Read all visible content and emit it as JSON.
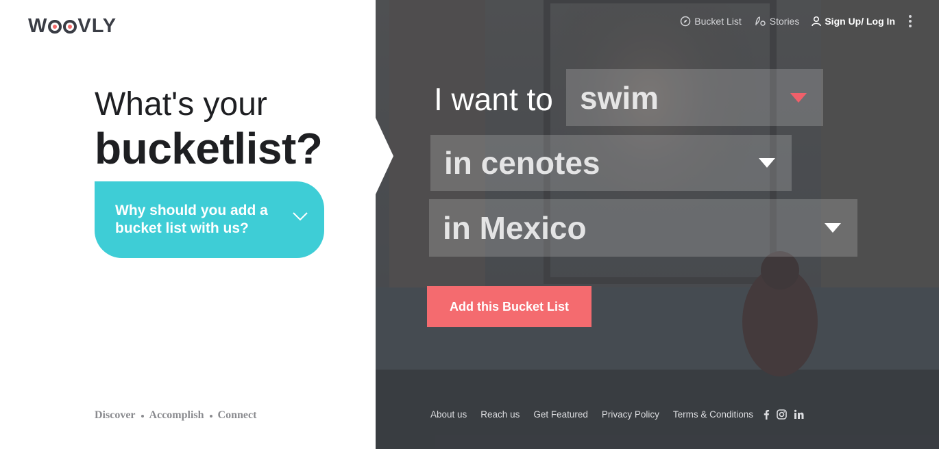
{
  "brand": {
    "logo": "WOOVLY"
  },
  "hero": {
    "line1": "What's your",
    "line2": "bucketlist?",
    "why_button": "Why should you add a bucket list with us?"
  },
  "left_footer": [
    "Discover",
    "Accomplish",
    "Connect"
  ],
  "nav": {
    "bucket_list": "Bucket List",
    "stories": "Stories",
    "login": "Sign Up/ Log In",
    "icons": [
      "compass-icon",
      "stories-icon",
      "user-icon",
      "more-vertical-icon"
    ]
  },
  "builder": {
    "prefix": "I want to",
    "activity": "swim",
    "place": "in cenotes",
    "country": "in Mexico",
    "submit": "Add this Bucket List"
  },
  "right_footer": {
    "links": [
      "About us",
      "Reach us",
      "Get Featured",
      "Privacy Policy",
      "Terms & Conditions"
    ],
    "social_icons": [
      "facebook-icon",
      "instagram-icon",
      "linkedin-icon"
    ]
  },
  "colors": {
    "accent_teal": "#3ecdd6",
    "accent_coral": "#f46b6f",
    "dropdown_arrow_active": "#f0606a",
    "text_dark": "#1e1f22"
  }
}
